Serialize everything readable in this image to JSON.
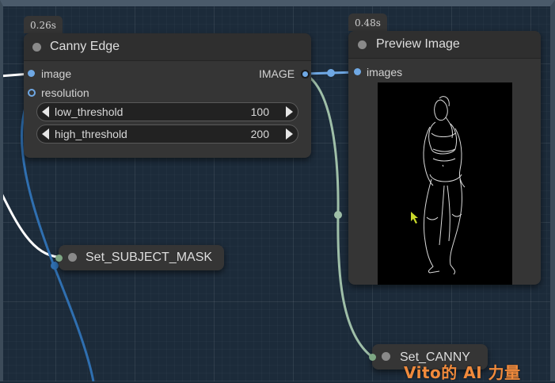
{
  "canny_node": {
    "time_badge": "0.26s",
    "title": "Canny Edge",
    "inputs": [
      "image",
      "resolution"
    ],
    "output": "IMAGE",
    "widgets": [
      {
        "label": "low_threshold",
        "value": "100"
      },
      {
        "label": "high_threshold",
        "value": "200"
      }
    ]
  },
  "preview_node": {
    "time_badge": "0.48s",
    "title": "Preview Image",
    "input": "images"
  },
  "set_subject_mask": {
    "title": "Set_SUBJECT_MASK"
  },
  "set_canny": {
    "title": "Set_CANNY"
  },
  "watermark": "Vito的 AI 力量",
  "colors": {
    "canvas": "#1c2b3a",
    "node": "#353535",
    "image_link": "#6fa8e4",
    "mask_link": "#9fbfa8",
    "resolution_link": "#2f6fb0",
    "watermark": "#f08a3c"
  }
}
